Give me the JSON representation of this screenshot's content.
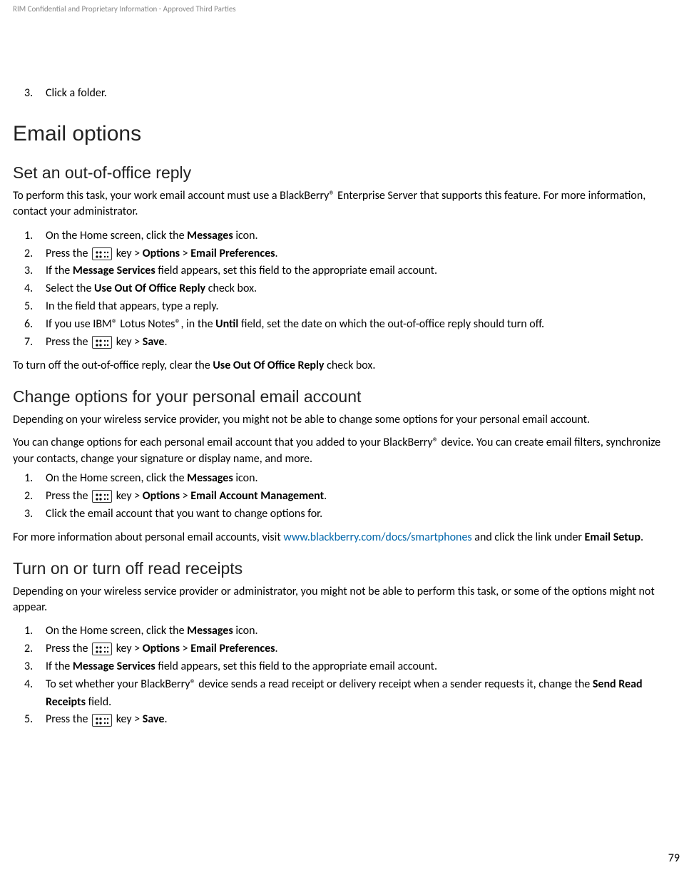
{
  "header": "RIM Confidential and Proprietary Information - Approved Third Parties",
  "page_number": "79",
  "continued_step": {
    "num": "3.",
    "text": "Click a folder."
  },
  "h1": "Email options",
  "sec1": {
    "title": "Set an out-of-office reply",
    "intro": "To perform this task, your work email account must use a BlackBerry® Enterprise Server that supports this feature. For more information, contact your administrator.",
    "steps": [
      {
        "num": "1.",
        "pre": "On the Home screen, click the ",
        "b1": "Messages",
        "post": " icon."
      },
      {
        "num": "2.",
        "pre": "Press the ",
        "icon": true,
        "mid1": " key > ",
        "b1": "Options",
        "mid2": " > ",
        "b2": "Email Preferences",
        "post": "."
      },
      {
        "num": "3.",
        "pre": "If the ",
        "b1": "Message Services",
        "post": " field appears, set this field to the appropriate email account."
      },
      {
        "num": "4.",
        "pre": "Select the ",
        "b1": "Use Out Of Office Reply",
        "post": " check box."
      },
      {
        "num": "5.",
        "pre": "In the field that appears, type a reply."
      },
      {
        "num": "6.",
        "pre": "If you use IBM® Lotus Notes®, in the ",
        "b1": "Until",
        "post": " field, set the date on which the out-of-office reply should turn off."
      },
      {
        "num": "7.",
        "pre": "Press the ",
        "icon": true,
        "mid1": " key > ",
        "b1": "Save",
        "post": "."
      }
    ],
    "outro_pre": "To turn off the out-of-office reply, clear the ",
    "outro_b": "Use Out Of Office Reply",
    "outro_post": " check box."
  },
  "sec2": {
    "title": "Change options for your personal email account",
    "p1": "Depending on your wireless service provider, you might not be able to change some options for your personal email account.",
    "p2": "You can change options for each personal email account that you added to your BlackBerry® device. You can create email filters, synchronize your contacts, change your signature or display name, and more.",
    "steps": [
      {
        "num": "1.",
        "pre": "On the Home screen, click the ",
        "b1": "Messages",
        "post": " icon."
      },
      {
        "num": "2.",
        "pre": "Press the ",
        "icon": true,
        "mid1": " key > ",
        "b1": "Options",
        "mid2": " > ",
        "b2": "Email Account Management",
        "post": "."
      },
      {
        "num": "3.",
        "pre": "Click the email account that you want to change options for."
      }
    ],
    "outro_pre": "For more information about personal email accounts, visit ",
    "outro_link": "www.blackberry.com/docs/smartphones",
    "outro_mid": " and click the link under ",
    "outro_b": "Email Setup",
    "outro_post": "."
  },
  "sec3": {
    "title": "Turn on or turn off read receipts",
    "p1": "Depending on your wireless service provider or administrator, you might not be able to perform this task, or some of the options might not appear.",
    "steps": [
      {
        "num": "1.",
        "pre": "On the Home screen, click the ",
        "b1": "Messages",
        "post": " icon."
      },
      {
        "num": "2.",
        "pre": "Press the ",
        "icon": true,
        "mid1": " key > ",
        "b1": "Options",
        "mid2": " > ",
        "b2": "Email Preferences",
        "post": "."
      },
      {
        "num": "3.",
        "pre": "If the ",
        "b1": "Message Services",
        "post": " field appears, set this field to the appropriate email account."
      },
      {
        "num": "4.",
        "pre": "To set whether your BlackBerry® device sends a read receipt or delivery receipt when a sender requests it, change the ",
        "b1": "Send Read Receipts",
        "post": " field."
      },
      {
        "num": "5.",
        "pre": "Press the ",
        "icon": true,
        "mid1": " key > ",
        "b1": "Save",
        "post": "."
      }
    ]
  }
}
